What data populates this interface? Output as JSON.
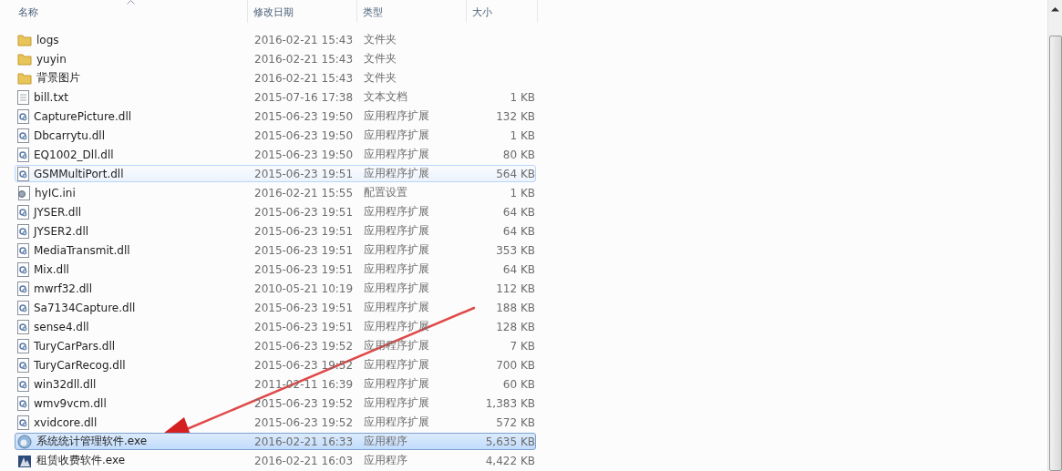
{
  "table": {
    "columns": [
      {
        "label": "名称",
        "sorted": true
      },
      {
        "label": "修改日期",
        "sorted": false
      },
      {
        "label": "类型",
        "sorted": false
      },
      {
        "label": "大小",
        "sorted": false
      }
    ],
    "rows": [
      {
        "kind": "folder",
        "name": "logs",
        "date": "2016-02-21 15:43",
        "type": "文件夹",
        "selected": false,
        "hovered": false
      },
      {
        "kind": "folder",
        "name": "yuyin",
        "date": "2016-02-21 15:43",
        "type": "文件夹",
        "selected": false,
        "hovered": false
      },
      {
        "kind": "folder",
        "name": "背景图片",
        "date": "2016-02-21 15:43",
        "type": "文件夹",
        "selected": false,
        "hovered": false
      },
      {
        "kind": "text",
        "name": "bill.txt",
        "date": "2015-07-16 17:38",
        "type": "文本文档",
        "size": "1 KB",
        "selected": false,
        "hovered": false
      },
      {
        "kind": "dll",
        "name": "CapturePicture.dll",
        "date": "2015-06-23 19:50",
        "type": "应用程序扩展",
        "size": "132 KB",
        "selected": false,
        "hovered": false
      },
      {
        "kind": "dll",
        "name": "Dbcarrytu.dll",
        "date": "2015-06-23 19:50",
        "type": "应用程序扩展",
        "size": "1 KB",
        "selected": false,
        "hovered": false
      },
      {
        "kind": "dll",
        "name": "EQ1002_Dll.dll",
        "date": "2015-06-23 19:50",
        "type": "应用程序扩展",
        "size": "80 KB",
        "selected": false,
        "hovered": false
      },
      {
        "kind": "dll",
        "name": "GSMMultiPort.dll",
        "date": "2015-06-23 19:51",
        "type": "应用程序扩展",
        "size": "564 KB",
        "selected": false,
        "hovered": true
      },
      {
        "kind": "config",
        "name": "hyIC.ini",
        "date": "2016-02-21 15:55",
        "type": "配置设置",
        "size": "1 KB",
        "selected": false,
        "hovered": false
      },
      {
        "kind": "dll",
        "name": "JYSER.dll",
        "date": "2015-06-23 19:51",
        "type": "应用程序扩展",
        "size": "64 KB",
        "selected": false,
        "hovered": false
      },
      {
        "kind": "dll",
        "name": "JYSER2.dll",
        "date": "2015-06-23 19:51",
        "type": "应用程序扩展",
        "size": "64 KB",
        "selected": false,
        "hovered": false
      },
      {
        "kind": "dll",
        "name": "MediaTransmit.dll",
        "date": "2015-06-23 19:51",
        "type": "应用程序扩展",
        "size": "353 KB",
        "selected": false,
        "hovered": false
      },
      {
        "kind": "dll",
        "name": "Mix.dll",
        "date": "2015-06-23 19:51",
        "type": "应用程序扩展",
        "size": "64 KB",
        "selected": false,
        "hovered": false
      },
      {
        "kind": "dll",
        "name": "mwrf32.dll",
        "date": "2010-05-21 10:19",
        "type": "应用程序扩展",
        "size": "112 KB",
        "selected": false,
        "hovered": false
      },
      {
        "kind": "dll",
        "name": "Sa7134Capture.dll",
        "date": "2015-06-23 19:51",
        "type": "应用程序扩展",
        "size": "188 KB",
        "selected": false,
        "hovered": false
      },
      {
        "kind": "dll",
        "name": "sense4.dll",
        "date": "2015-06-23 19:51",
        "type": "应用程序扩展",
        "size": "128 KB",
        "selected": false,
        "hovered": false
      },
      {
        "kind": "dll",
        "name": "TuryCarPars.dll",
        "date": "2015-06-23 19:52",
        "type": "应用程序扩展",
        "size": "7 KB",
        "selected": false,
        "hovered": false
      },
      {
        "kind": "dll",
        "name": "TuryCarRecog.dll",
        "date": "2015-06-23 19:52",
        "type": "应用程序扩展",
        "size": "700 KB",
        "selected": false,
        "hovered": false
      },
      {
        "kind": "dll",
        "name": "win32dll.dll",
        "date": "2011-02-11 16:39",
        "type": "应用程序扩展",
        "size": "60 KB",
        "selected": false,
        "hovered": false
      },
      {
        "kind": "dll",
        "name": "wmv9vcm.dll",
        "date": "2015-06-23 19:52",
        "type": "应用程序扩展",
        "size": "1,383 KB",
        "selected": false,
        "hovered": false
      },
      {
        "kind": "dll",
        "name": "xvidcore.dll",
        "date": "2015-06-23 19:52",
        "type": "应用程序扩展",
        "size": "572 KB",
        "selected": false,
        "hovered": false
      },
      {
        "kind": "app",
        "name": "系统统计管理软件.exe",
        "date": "2016-02-21 16:33",
        "type": "应用程序",
        "size": "5,635 KB",
        "selected": true,
        "hovered": false
      },
      {
        "kind": "app2",
        "name": "租赁收费软件.exe",
        "date": "2016-02-21 16:03",
        "type": "应用程序",
        "size": "4,422 KB",
        "selected": false,
        "hovered": false
      }
    ]
  }
}
